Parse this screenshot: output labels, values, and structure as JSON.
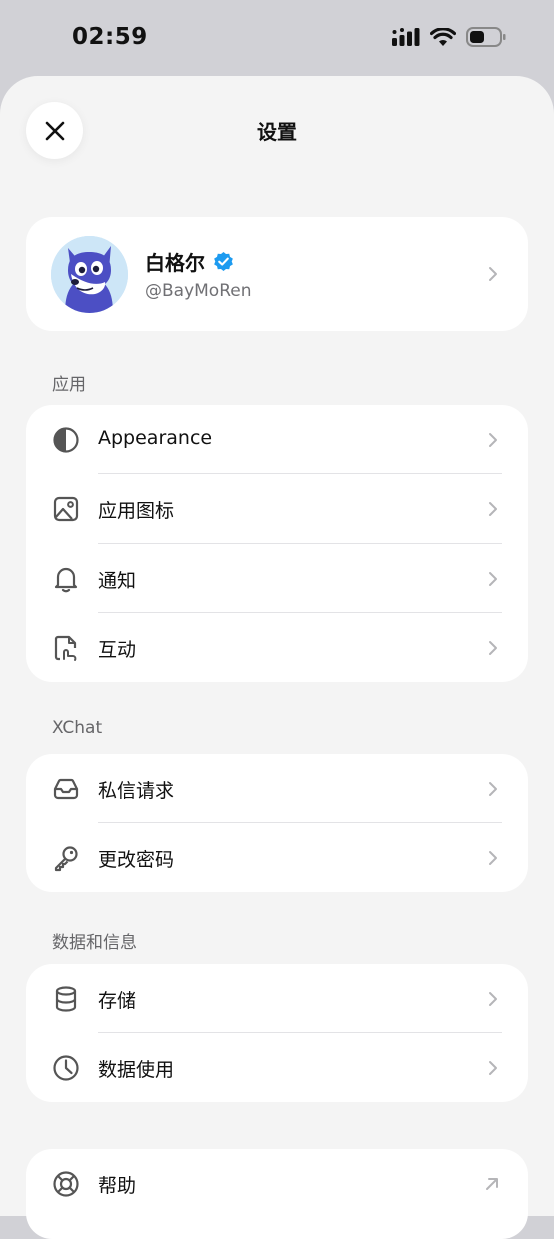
{
  "status_bar": {
    "time": "02:59"
  },
  "sheet": {
    "title": "设置"
  },
  "profile": {
    "name": "白格尔",
    "handle": "@BayMoRen",
    "verified": true
  },
  "sections": [
    {
      "label": "应用",
      "items": [
        {
          "icon": "half-circle-icon",
          "label": "Appearance",
          "action": "chevron"
        },
        {
          "icon": "image-icon",
          "label": "应用图标",
          "action": "chevron"
        },
        {
          "icon": "bell-icon",
          "label": "通知",
          "action": "chevron"
        },
        {
          "icon": "interaction-icon",
          "label": "互动",
          "action": "chevron"
        }
      ]
    },
    {
      "label": "XChat",
      "items": [
        {
          "icon": "inbox-icon",
          "label": "私信请求",
          "action": "chevron"
        },
        {
          "icon": "key-icon",
          "label": "更改密码",
          "action": "chevron"
        }
      ]
    },
    {
      "label": "数据和信息",
      "items": [
        {
          "icon": "database-icon",
          "label": "存储",
          "action": "chevron"
        },
        {
          "icon": "clock-icon",
          "label": "数据使用",
          "action": "chevron"
        }
      ]
    },
    {
      "label": "",
      "items": [
        {
          "icon": "lifebuoy-icon",
          "label": "帮助",
          "action": "external"
        }
      ]
    }
  ],
  "colors": {
    "accent": "#1d9bf0",
    "icon": "#555555",
    "chevron": "#b5b5b8"
  }
}
